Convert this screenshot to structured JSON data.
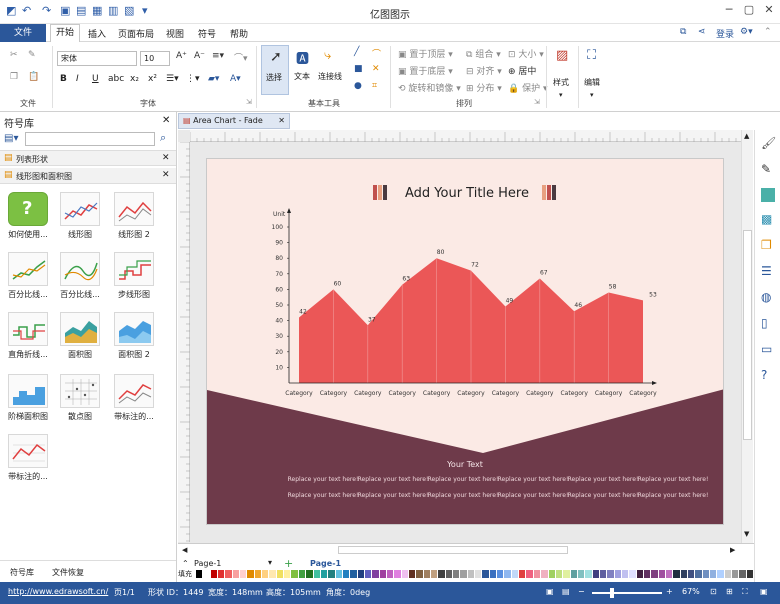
{
  "app": {
    "title": "亿图图示",
    "login": "登录"
  },
  "menu": {
    "file": "文件",
    "home": "开始",
    "insert": "插入",
    "page_layout": "页面布局",
    "view": "视图",
    "symbol": "符号",
    "help": "帮助"
  },
  "ribbon": {
    "font_name": "宋体",
    "font_size": "10",
    "select": "选择",
    "text": "文本",
    "connector": "连接线",
    "bring_front": "置于顶层",
    "send_back": "置于底层",
    "rotate_mirror": "旋转和镜像",
    "group": "组合",
    "align": "对齐",
    "distribute": "分布",
    "size": "大小",
    "center": "居中",
    "protect": "保护",
    "style": "样式",
    "edit": "编辑",
    "groups": {
      "file": "文件",
      "font": "字体",
      "basic_tools": "基本工具",
      "arrange": "排列"
    }
  },
  "left_panel": {
    "title": "符号库",
    "search_placeholder": "",
    "categories": [
      "列表形状",
      "线形图和面积图"
    ],
    "symbols": [
      "如何使用...",
      "线形图",
      "线形图 2",
      "百分比线...",
      "百分比线...",
      "步线形图",
      "直角折线...",
      "面积图",
      "面积图 2",
      "阶梯面积图",
      "散点图",
      "带标注的...",
      "带标注的..."
    ],
    "bottom_tabs": [
      "符号库",
      "文件恢复"
    ]
  },
  "document": {
    "tab_label": "Area Chart - Fade"
  },
  "pages": {
    "current": "Page-1",
    "active": "Page-1"
  },
  "palette_label": "填充",
  "status": {
    "url": "http://www.edrawsoft.cn/",
    "page": "页1/1",
    "shape_id": "形状 ID：1449",
    "width": "宽度：148mm",
    "height": "高度：105mm",
    "angle": "角度：0deg",
    "zoom": "67%"
  },
  "chart_data": {
    "type": "area",
    "title": "Add Your Title Here",
    "ylabel": "Unit",
    "ylim": [
      0,
      100
    ],
    "y_ticks": [
      10,
      20,
      30,
      40,
      50,
      60,
      70,
      80,
      90,
      100
    ],
    "categories": [
      "Category",
      "Category",
      "Category",
      "Category",
      "Category",
      "Category",
      "Category",
      "Category",
      "Category",
      "Category",
      "Category"
    ],
    "values": [
      42,
      60,
      37,
      63,
      80,
      72,
      49,
      67,
      46,
      58,
      53
    ],
    "color": "#eb5757"
  },
  "footer": {
    "heading": "Your Text",
    "lines": [
      "Replace your text here!",
      "Replace your text here!",
      "Replace your text here!",
      "Replace your text here!",
      "Replace your text here!",
      "Replace your text here!"
    ]
  },
  "colors": {
    "accent": "#2b579a",
    "band": "#6e3a4a",
    "page_bg": "#fbeae5"
  }
}
